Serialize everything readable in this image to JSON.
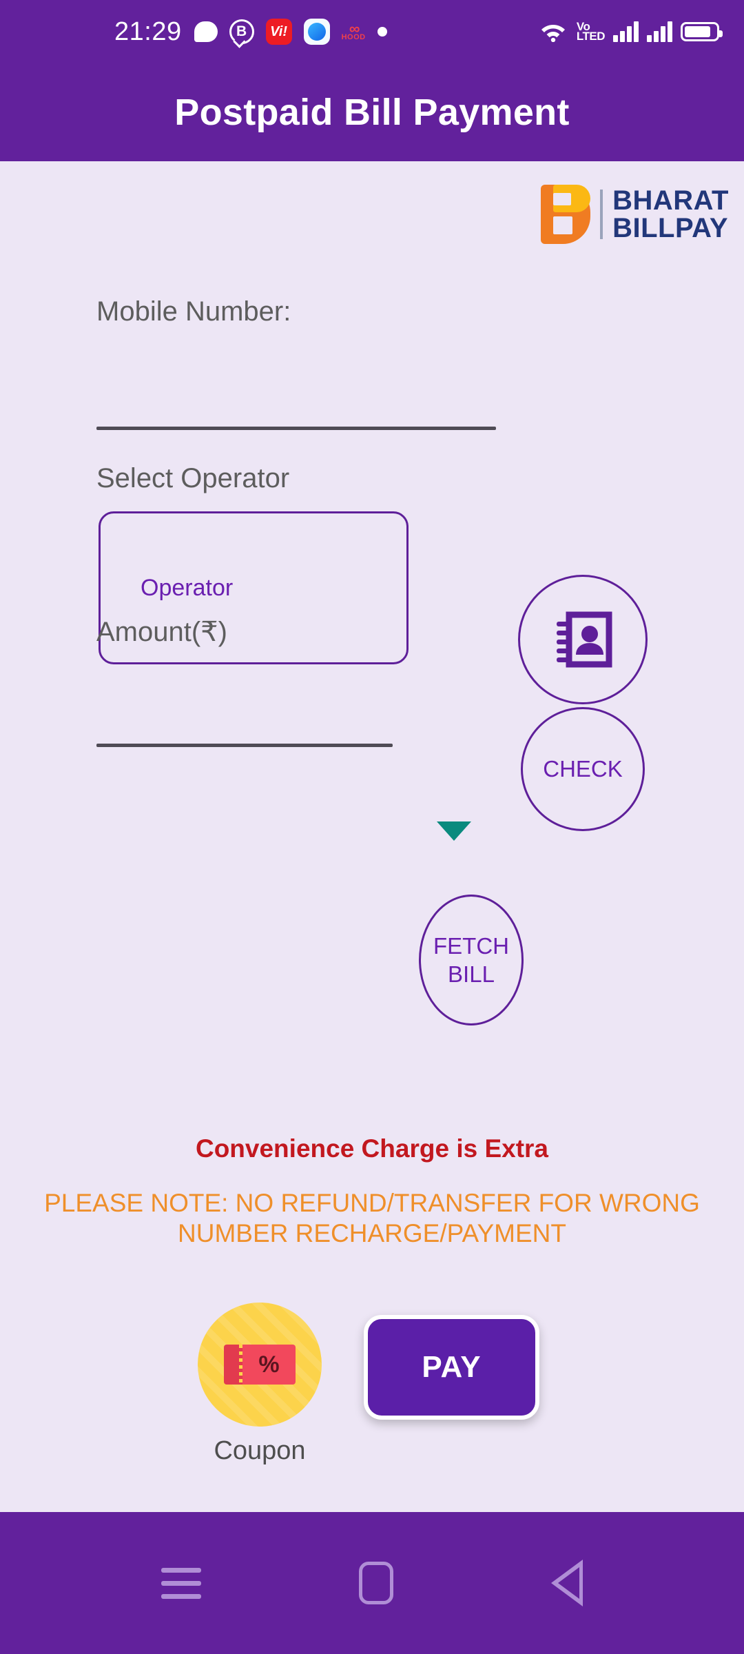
{
  "status_bar": {
    "clock": "21:29",
    "notification_icons": [
      "chat-bubble-icon",
      "b-messenger-icon",
      "vi-app-icon",
      "browser-globe-icon",
      "hood-app-icon",
      "dot-icon"
    ],
    "hood_label": "HOOD",
    "hood_symbol": "∞",
    "b_symbol": "B",
    "vi_symbol": "Vi!",
    "network_label_top": "Vo",
    "network_label_bottom": "LTED",
    "right_icons": [
      "wifi-icon",
      "volte-icon",
      "signal-bars-sim1-icon",
      "signal-bars-sim2-icon",
      "battery-icon"
    ]
  },
  "app_bar": {
    "title": "Postpaid Bill Payment"
  },
  "brand": {
    "line1": "BHARAT",
    "line2": "BILLPAY",
    "mark_letter": "B"
  },
  "form": {
    "mobile_label": "Mobile Number:",
    "mobile_value": "",
    "mobile_placeholder": "",
    "contacts_button": "contacts-icon",
    "operator_label": "Select Operator",
    "operator_value": "Operator",
    "operator_options": [
      "Operator"
    ],
    "check_button": "CHECK",
    "amount_label": "Amount(₹)",
    "amount_value": "",
    "amount_placeholder": "",
    "fetch_button_line1": "FETCH",
    "fetch_button_line2": "BILL"
  },
  "notices": {
    "convenience": "Convenience Charge is Extra",
    "please_note": "PLEASE NOTE: NO REFUND/TRANSFER FOR WRONG NUMBER RECHARGE/PAYMENT"
  },
  "actions": {
    "coupon_label": "Coupon",
    "coupon_symbol": "%",
    "pay_label": "PAY"
  },
  "nav_bar": {
    "recents": "menu-icon",
    "home": "home-icon",
    "back": "back-icon"
  },
  "colors": {
    "primary_purple": "#62219c",
    "pay_purple": "#5b1fa8",
    "background": "#ede6f5",
    "notice_red": "#c2181f",
    "notice_orange": "#ef8f2a",
    "caret_teal": "#0a8a7e",
    "coupon_yellow": "#FCD34B",
    "brand_orange": "#F07C22",
    "brand_blue": "#22377a"
  }
}
